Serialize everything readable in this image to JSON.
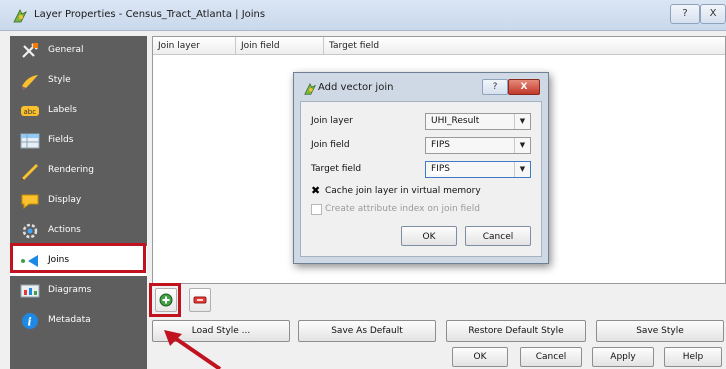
{
  "window": {
    "title": "Layer Properties - Census_Tract_Atlanta | Joins",
    "help_label": "?",
    "close_label": "X"
  },
  "sidebar": {
    "items": [
      {
        "label": "General",
        "icon": "general-icon"
      },
      {
        "label": "Style",
        "icon": "style-icon"
      },
      {
        "label": "Labels",
        "icon": "labels-icon"
      },
      {
        "label": "Fields",
        "icon": "fields-icon"
      },
      {
        "label": "Rendering",
        "icon": "rendering-icon"
      },
      {
        "label": "Display",
        "icon": "display-icon"
      },
      {
        "label": "Actions",
        "icon": "actions-icon"
      },
      {
        "label": "Joins",
        "icon": "joins-icon",
        "selected": true
      },
      {
        "label": "Diagrams",
        "icon": "diagrams-icon"
      },
      {
        "label": "Metadata",
        "icon": "metadata-icon"
      }
    ]
  },
  "joins_table": {
    "columns": [
      "Join layer",
      "Join field",
      "Target field"
    ]
  },
  "dialog": {
    "title": "Add vector join",
    "help_label": "?",
    "close_label": "X",
    "join_layer_label": "Join layer",
    "join_layer_value": "UHI_Result",
    "join_field_label": "Join field",
    "join_field_value": "FIPS",
    "target_field_label": "Target field",
    "target_field_value": "FIPS",
    "cache_label": "Cache join layer in virtual memory",
    "cache_checked": true,
    "index_label": "Create attribute index on join field",
    "index_checked": false,
    "ok_label": "OK",
    "cancel_label": "Cancel"
  },
  "style_buttons": {
    "load": "Load Style ...",
    "save_default": "Save As Default",
    "restore_default": "Restore Default Style",
    "save_style": "Save Style"
  },
  "bottom_buttons": {
    "ok": "OK",
    "cancel": "Cancel",
    "apply": "Apply",
    "help": "Help"
  },
  "colors": {
    "highlight": "#c1121f",
    "sidebar_bg": "#5e5e5e"
  }
}
